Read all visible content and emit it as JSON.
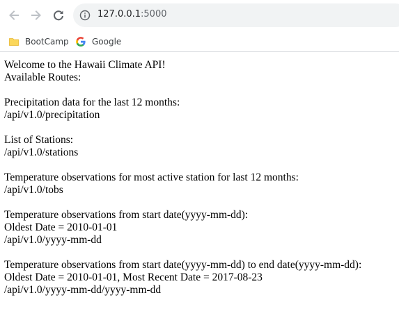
{
  "browser": {
    "url_host": "127.0.0.1",
    "url_port": ":5000",
    "bookmarks": [
      {
        "label": "BootCamp",
        "icon": "folder-icon"
      },
      {
        "label": "Google",
        "icon": "google-icon"
      }
    ]
  },
  "page": {
    "welcome": "Welcome to the Hawaii Climate API!",
    "available_routes": "Available Routes:",
    "precipitation_title": "Precipitation data for the last 12 months:",
    "precipitation_route": "/api/v1.0/precipitation",
    "stations_title": "List of Stations:",
    "stations_route": "/api/v1.0/stations",
    "tobs_title": "Temperature observations for most active station for last 12 months:",
    "tobs_route": "/api/v1.0/tobs",
    "start_title": "Temperature observations from start date(yyyy-mm-dd):",
    "start_oldest": "Oldest Date = 2010-01-01",
    "start_route": "/api/v1.0/yyyy-mm-dd",
    "range_title": "Temperature observations from start date(yyyy-mm-dd) to end date(yyyy-mm-dd):",
    "range_dates": "Oldest Date = 2010-01-01, Most Recent Date = 2017-08-23",
    "range_route": "/api/v1.0/yyyy-mm-dd/yyyy-mm-dd"
  },
  "colors": {
    "chrome_icon": "#5f6368",
    "disabled_icon": "#bdc1c6",
    "omnibox_bg": "#f1f3f4",
    "folder": "#fbd75b"
  }
}
